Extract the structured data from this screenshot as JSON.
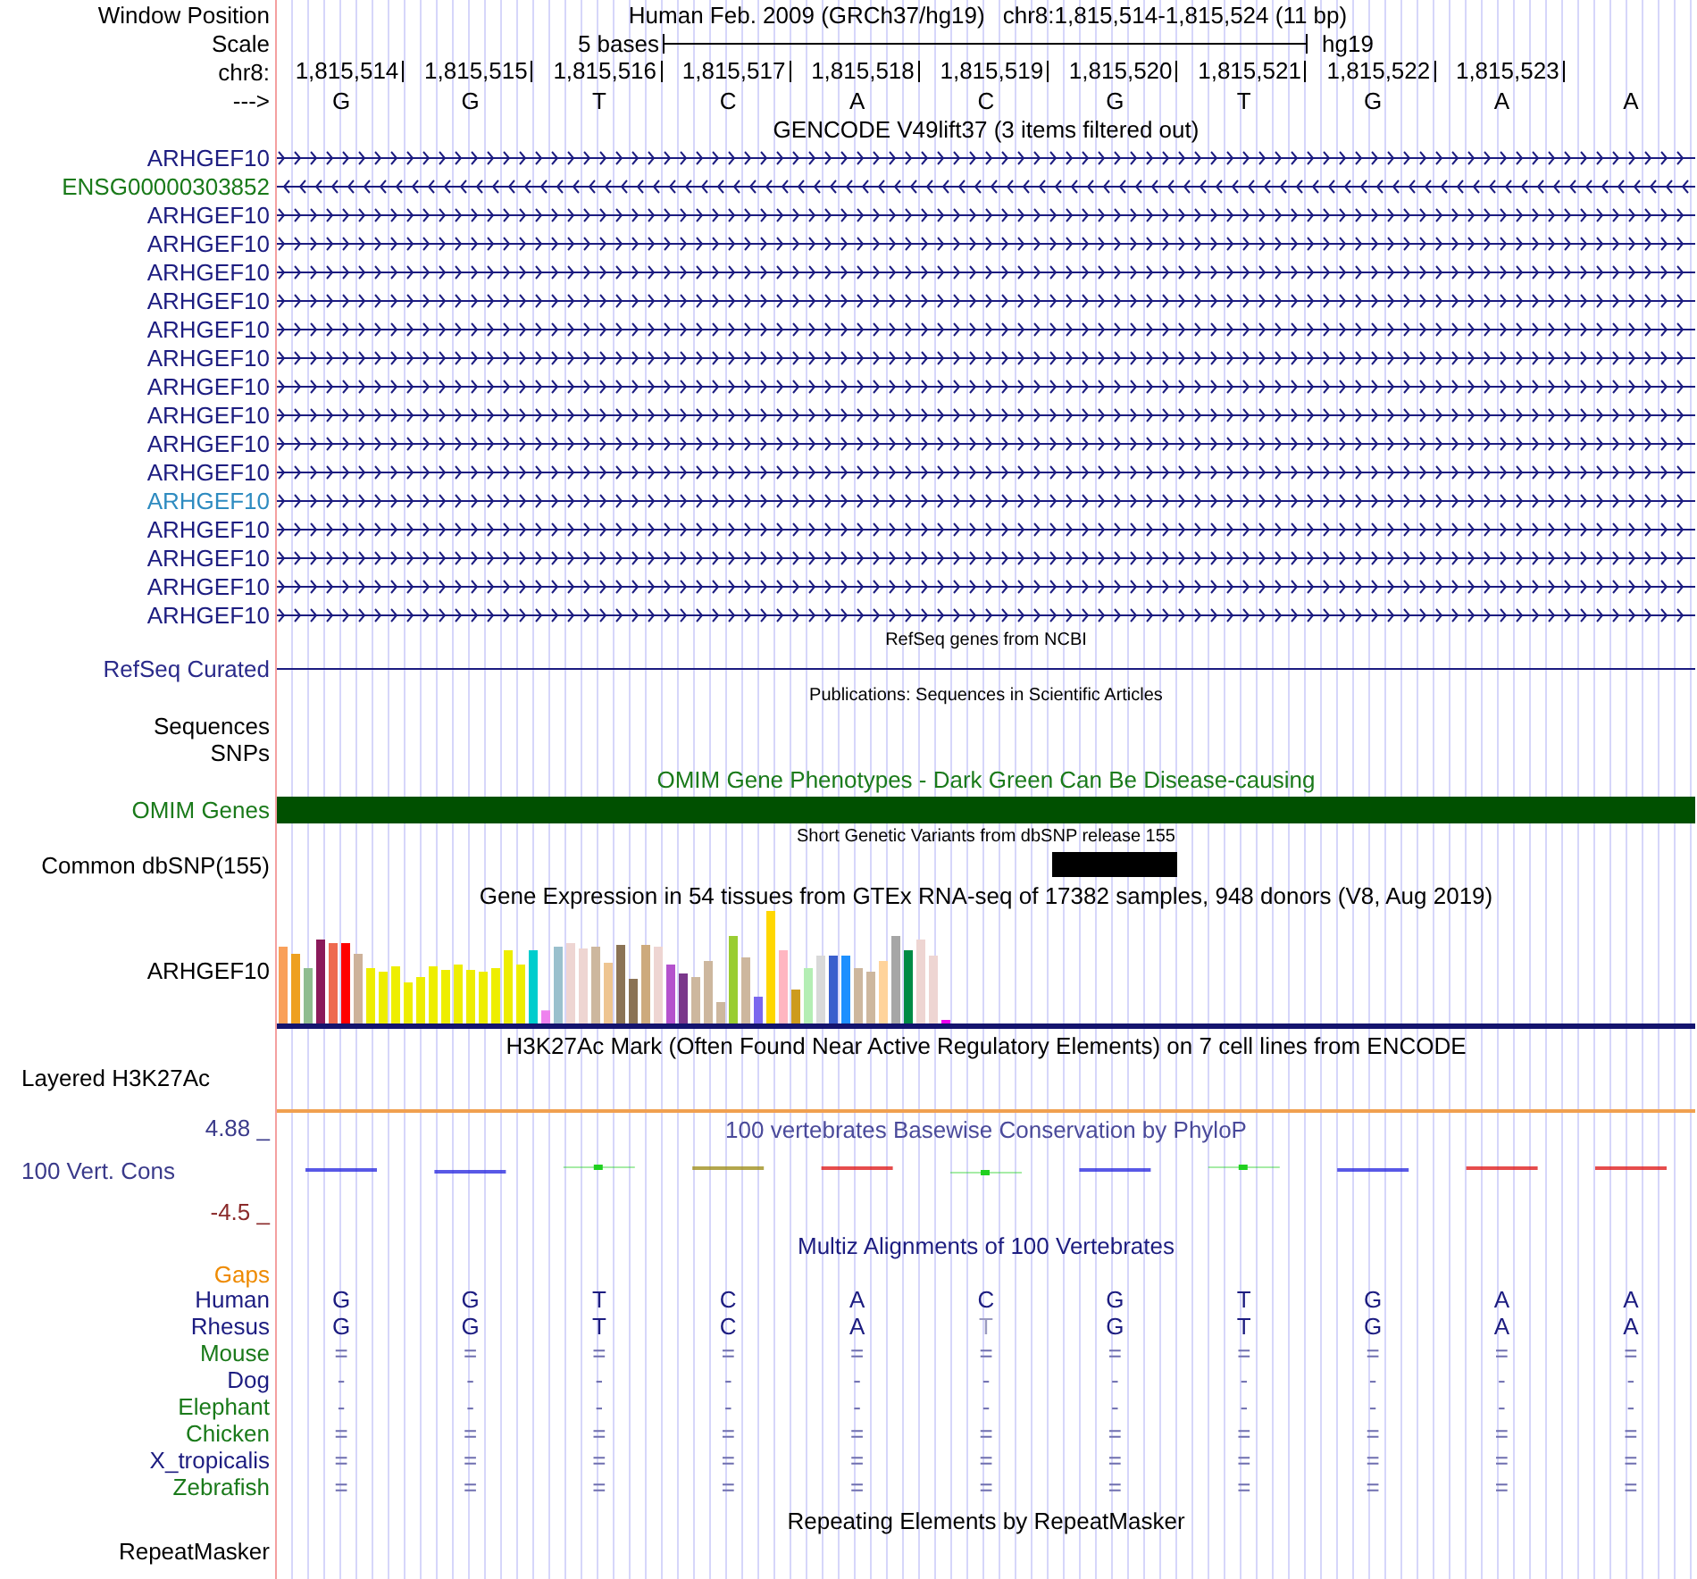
{
  "header": {
    "label": "Window Position",
    "assembly": "Human Feb. 2009 (GRCh37/hg19)",
    "position": "chr8:1,815,514-1,815,524 (11 bp)"
  },
  "scale": {
    "label": "Scale",
    "span": "5 bases",
    "assembly": "hg19"
  },
  "chromosome": {
    "label": "chr8:",
    "positions": [
      "1,815,514",
      "1,815,515",
      "1,815,516",
      "1,815,517",
      "1,815,518",
      "1,815,519",
      "1,815,520",
      "1,815,521",
      "1,815,522",
      "1,815,523"
    ]
  },
  "sequence": {
    "label": "--->",
    "bases": [
      "G",
      "G",
      "T",
      "C",
      "A",
      "C",
      "G",
      "T",
      "G",
      "A",
      "A"
    ]
  },
  "gencode": {
    "title": "GENCODE V49lift37 (3 items filtered out)",
    "items": [
      {
        "name": "ARHGEF10",
        "color": "#1c1c80",
        "reverse": false
      },
      {
        "name": "ENSG00000303852",
        "color": "#1a7a1a",
        "reverse": true
      },
      {
        "name": "ARHGEF10",
        "color": "#1c1c80",
        "reverse": false
      },
      {
        "name": "ARHGEF10",
        "color": "#1c1c80",
        "reverse": false
      },
      {
        "name": "ARHGEF10",
        "color": "#1c1c80",
        "reverse": false
      },
      {
        "name": "ARHGEF10",
        "color": "#1c1c80",
        "reverse": false
      },
      {
        "name": "ARHGEF10",
        "color": "#1c1c80",
        "reverse": false
      },
      {
        "name": "ARHGEF10",
        "color": "#1c1c80",
        "reverse": false
      },
      {
        "name": "ARHGEF10",
        "color": "#1c1c80",
        "reverse": false
      },
      {
        "name": "ARHGEF10",
        "color": "#1c1c80",
        "reverse": false
      },
      {
        "name": "ARHGEF10",
        "color": "#1c1c80",
        "reverse": false
      },
      {
        "name": "ARHGEF10",
        "color": "#1c1c80",
        "reverse": false
      },
      {
        "name": "ARHGEF10",
        "color": "#2e8bc0",
        "reverse": false
      },
      {
        "name": "ARHGEF10",
        "color": "#1c1c80",
        "reverse": false
      },
      {
        "name": "ARHGEF10",
        "color": "#1c1c80",
        "reverse": false
      },
      {
        "name": "ARHGEF10",
        "color": "#1c1c80",
        "reverse": false
      },
      {
        "name": "ARHGEF10",
        "color": "#1c1c80",
        "reverse": false
      }
    ]
  },
  "refseq": {
    "title": "RefSeq genes from NCBI",
    "label": "RefSeq Curated"
  },
  "publications": {
    "title": "Publications: Sequences in Scientific Articles",
    "labels": [
      "Sequences",
      "SNPs"
    ]
  },
  "omim": {
    "title": "OMIM Gene Phenotypes - Dark Green Can Be Disease-causing",
    "label": "OMIM Genes"
  },
  "dbsnp": {
    "title": "Short Genetic Variants from dbSNP release 155",
    "label": "Common dbSNP(155)"
  },
  "gtex": {
    "title": "Gene Expression in 54 tissues from GTEx RNA-seq of 17382 samples, 948 donors (V8, Aug 2019)",
    "label": "ARHGEF10"
  },
  "h3k27ac": {
    "title": "H3K27Ac Mark (Often Found Near Active Regulatory Elements) on 7 cell lines from ENCODE",
    "label": "Layered H3K27Ac"
  },
  "phylop": {
    "title": "100 vertebrates Basewise Conservation by PhyloP",
    "label": "100 Vert. Cons",
    "max": "4.88 _",
    "min": "-4.5 _"
  },
  "multiz": {
    "title": "Multiz Alignments of 100 Vertebrates",
    "gaps_label": "Gaps",
    "species": [
      {
        "name": "Human",
        "color": "#1c1c80",
        "cells": [
          "G",
          "G",
          "T",
          "C",
          "A",
          "C",
          "G",
          "T",
          "G",
          "A",
          "A"
        ]
      },
      {
        "name": "Rhesus",
        "color": "#1c1c80",
        "cells": [
          "G",
          "G",
          "T",
          "C",
          "A",
          "T",
          "G",
          "T",
          "G",
          "A",
          "A"
        ],
        "dimmed": [
          false,
          false,
          false,
          false,
          false,
          true,
          false,
          false,
          false,
          false,
          false
        ]
      },
      {
        "name": "Mouse",
        "color": "#1a7a1a",
        "cells": [
          "=",
          "=",
          "=",
          "=",
          "=",
          "=",
          "=",
          "=",
          "=",
          "=",
          "="
        ]
      },
      {
        "name": "Dog",
        "color": "#1c1c80",
        "cells": [
          "-",
          "-",
          "-",
          "-",
          "-",
          "-",
          "-",
          "-",
          "-",
          "-",
          "-"
        ]
      },
      {
        "name": "Elephant",
        "color": "#1a7a1a",
        "cells": [
          "-",
          "-",
          "-",
          "-",
          "-",
          "-",
          "-",
          "-",
          "-",
          "-",
          "-"
        ]
      },
      {
        "name": "Chicken",
        "color": "#1a7a1a",
        "cells": [
          "=",
          "=",
          "=",
          "=",
          "=",
          "=",
          "=",
          "=",
          "=",
          "=",
          "="
        ]
      },
      {
        "name": "X_tropicalis",
        "color": "#1c1c80",
        "cells": [
          "=",
          "=",
          "=",
          "=",
          "=",
          "=",
          "=",
          "=",
          "=",
          "=",
          "="
        ]
      },
      {
        "name": "Zebrafish",
        "color": "#1a7a1a",
        "cells": [
          "=",
          "=",
          "=",
          "=",
          "=",
          "=",
          "=",
          "=",
          "=",
          "=",
          "="
        ]
      }
    ]
  },
  "repeatmasker": {
    "title": "Repeating Elements by RepeatMasker",
    "label": "RepeatMasker"
  }
}
